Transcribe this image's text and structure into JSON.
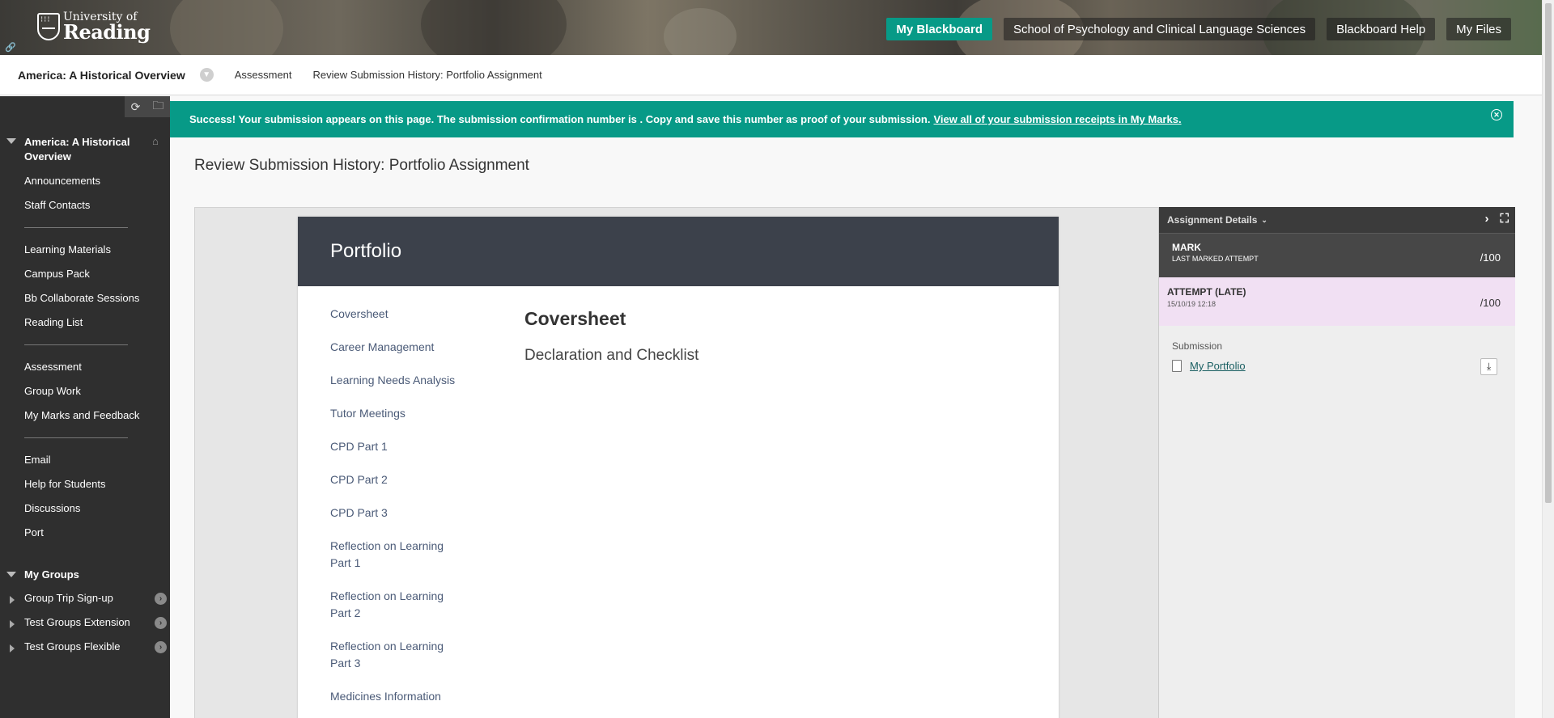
{
  "header": {
    "logo_line1": "University of",
    "logo_line2": "Reading",
    "nav": [
      {
        "label": "My Blackboard",
        "active": true
      },
      {
        "label": "School of Psychology and Clinical Language Sciences"
      },
      {
        "label": "Blackboard Help"
      },
      {
        "label": "My Files"
      }
    ]
  },
  "breadcrumb": {
    "course": "America: A Historical Overview",
    "items": [
      "Assessment",
      "Review Submission History: Portfolio Assignment"
    ]
  },
  "sidebar": {
    "course_title": "America: A Historical Overview",
    "items": [
      "Announcements",
      "Staff Contacts",
      "Learning Materials",
      "Campus Pack",
      "Bb Collaborate Sessions",
      "Reading List",
      "Assessment",
      "Group Work",
      "My Marks and Feedback",
      "Email",
      "Help for Students",
      "Discussions",
      "Port"
    ],
    "groups_heading": "My Groups",
    "groups": [
      "Group Trip Sign-up",
      "Test Groups Extension",
      "Test Groups Flexible"
    ]
  },
  "success": {
    "message": "Success! Your submission appears on this page. The submission confirmation number is . Copy and save this number as proof of your submission.",
    "link": "View all of your submission receipts in My Marks."
  },
  "page_title": "Review Submission History: Portfolio Assignment",
  "document": {
    "banner_title": "Portfolio",
    "toc": [
      "Coversheet",
      "Career Management",
      "Learning Needs Analysis",
      "Tutor Meetings",
      "CPD Part 1",
      "CPD Part 2",
      "CPD Part 3",
      "Reflection on Learning Part 1",
      "Reflection on Learning Part 2",
      "Reflection on Learning Part 3",
      "Medicines Information"
    ],
    "heading": "Coversheet",
    "subheading": "Declaration and Checklist"
  },
  "details": {
    "title": "Assignment Details",
    "mark_label": "MARK",
    "mark_sub": "LAST MARKED ATTEMPT",
    "mark_score": "/100",
    "attempt_label": "ATTEMPT (LATE)",
    "attempt_date": "15/10/19 12:18",
    "attempt_score": "/100",
    "submission_label": "Submission",
    "file_name": "My Portfolio"
  },
  "colors": {
    "accent": "#079a87",
    "sidebar_bg": "#2f2f2f",
    "attempt_bg": "#f1e0f3"
  }
}
